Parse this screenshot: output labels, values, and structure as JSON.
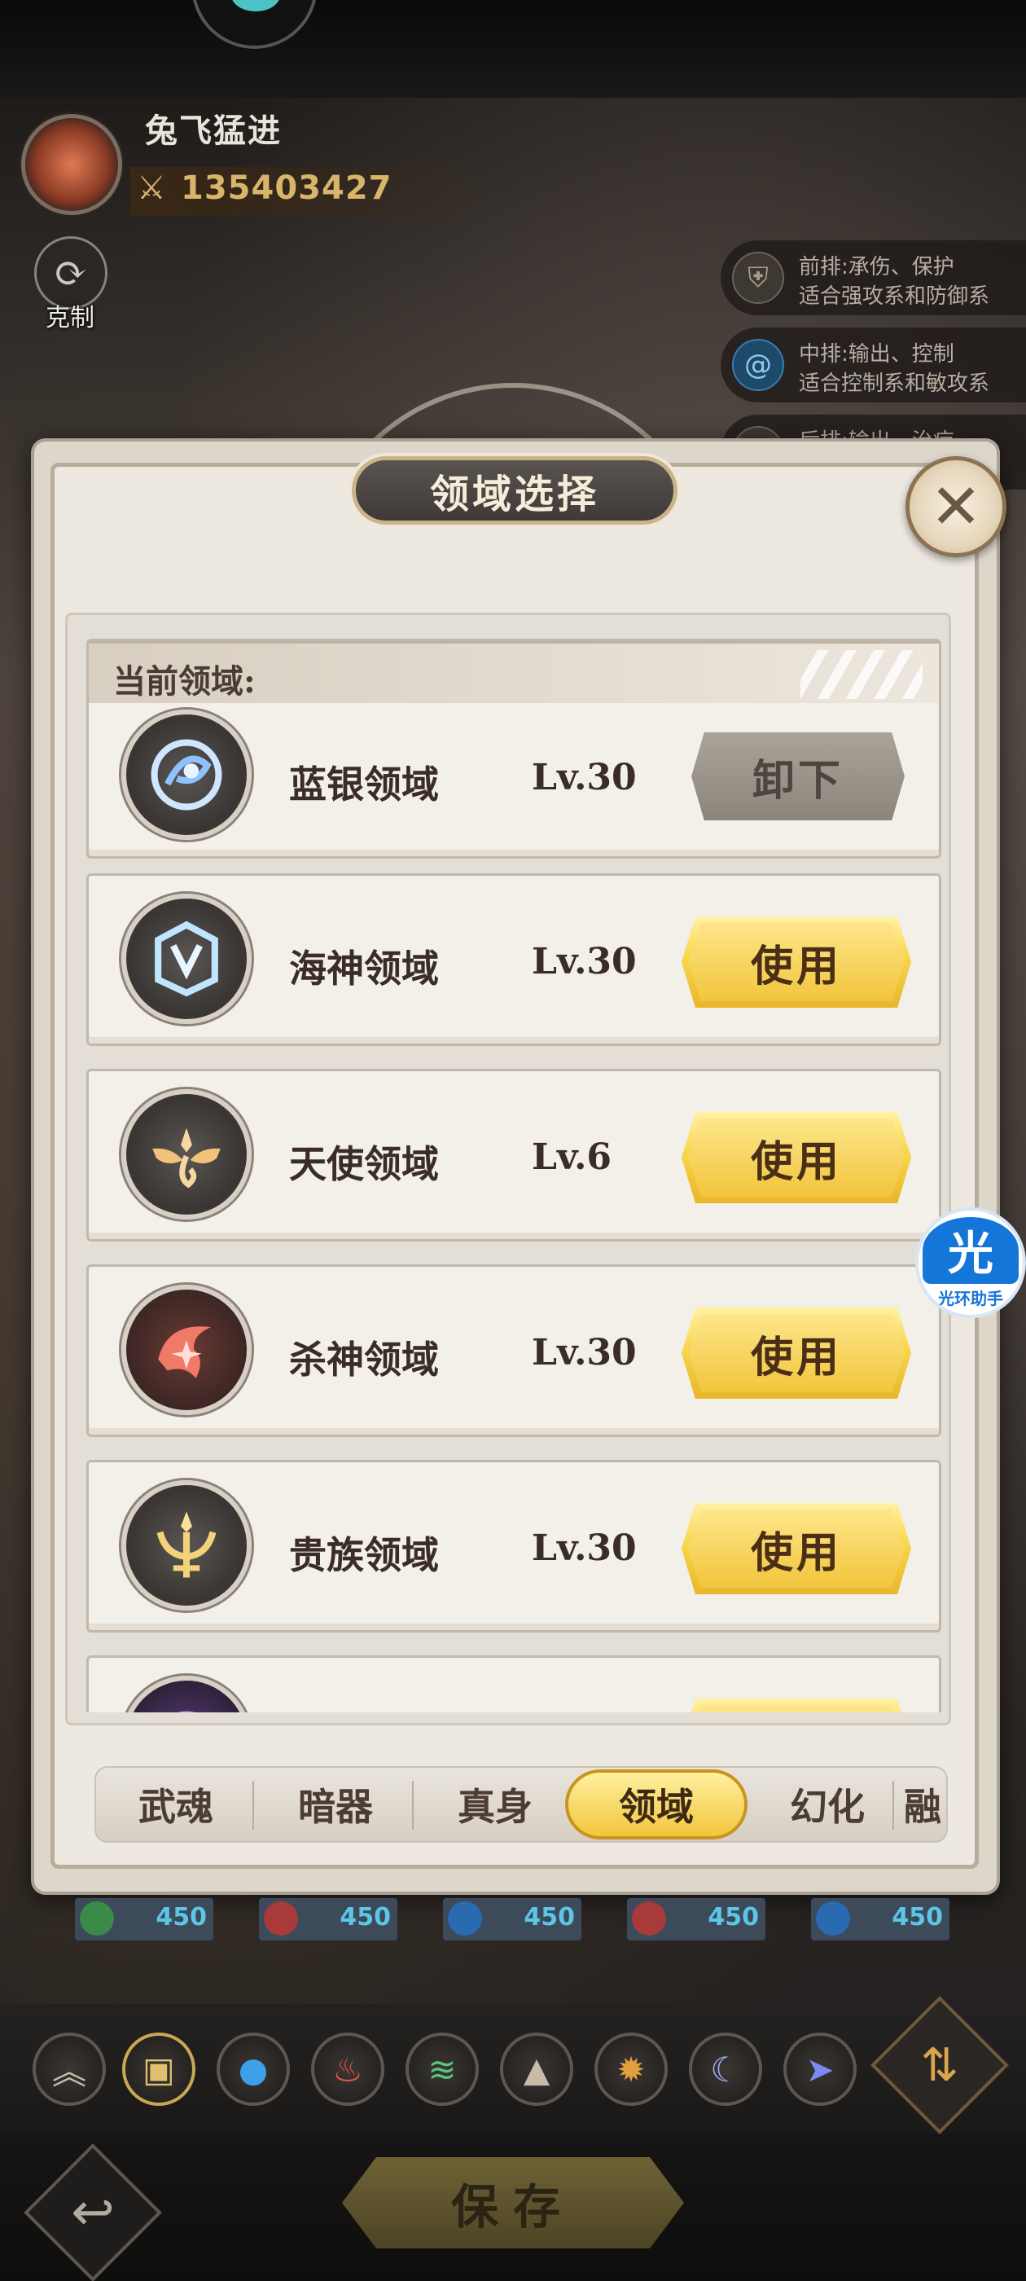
{
  "player": {
    "name": "兔飞猛进",
    "power": "135403427",
    "counter_label": "克制"
  },
  "position_hints": [
    {
      "line1": "前排:承伤、保护",
      "line2": "适合强攻系和防御系",
      "icon": "shield-icon"
    },
    {
      "line1": "中排:输出、控制",
      "line2": "适合控制系和敏攻系",
      "icon": "swirl-icon"
    },
    {
      "line1": "后排:输出、治疗",
      "line2": "",
      "icon": "heal-icon"
    }
  ],
  "modal": {
    "title": "领域选择",
    "close_icon": "close-icon",
    "current_header": "当前领域:"
  },
  "current_domain": {
    "name": "蓝银领域",
    "level": "Lv.30",
    "action": "卸下",
    "icon": "bluesilver-emblem-icon",
    "color": "#5fa2e8"
  },
  "domains": [
    {
      "name": "海神领域",
      "level": "Lv.30",
      "action": "使用",
      "icon": "trident-crown-emblem-icon",
      "color": "#7fc8f2"
    },
    {
      "name": "天使领域",
      "level": "Lv.6",
      "action": "使用",
      "icon": "angel-wing-emblem-icon",
      "color": "#f0c27a"
    },
    {
      "name": "杀神领域",
      "level": "Lv.30",
      "action": "使用",
      "icon": "slaughter-emblem-icon",
      "color": "#f07a66"
    },
    {
      "name": "贵族领域",
      "level": "Lv.30",
      "action": "使用",
      "icon": "noble-trident-emblem-icon",
      "color": "#f3d27a"
    },
    {
      "name": "",
      "level": "",
      "action": "",
      "icon": "purple-emblem-icon",
      "color": "#a07ae0"
    }
  ],
  "tabs": [
    {
      "label": "武魂",
      "active": false
    },
    {
      "label": "暗器",
      "active": false
    },
    {
      "label": "真身",
      "active": false
    },
    {
      "label": "领域",
      "active": true
    },
    {
      "label": "幻化",
      "active": false
    },
    {
      "label": "融",
      "active": false
    }
  ],
  "lineup_slots": [
    "450",
    "450",
    "450",
    "450",
    "450"
  ],
  "filters": [
    {
      "icon": "rank-chevron-icon",
      "active": false
    },
    {
      "icon": "box-icon",
      "active": true
    },
    {
      "icon": "water-drop-icon",
      "active": false
    },
    {
      "icon": "fire-icon",
      "active": false
    },
    {
      "icon": "wind-icon",
      "active": false
    },
    {
      "icon": "mountain-icon",
      "active": false
    },
    {
      "icon": "sun-gear-icon",
      "active": false
    },
    {
      "icon": "moon-icon",
      "active": false
    },
    {
      "icon": "arrow-icon",
      "active": false
    }
  ],
  "bottom": {
    "save_label": "保存",
    "back_icon": "back-arrow-icon",
    "sort_icon": "sort-arrows-icon"
  },
  "helper_badge": {
    "glyph": "光",
    "caption": "光环助手"
  },
  "colors": {
    "gold_button": "#f8d64a",
    "panel": "#ede8e0",
    "accent_blue": "#1576d9"
  }
}
